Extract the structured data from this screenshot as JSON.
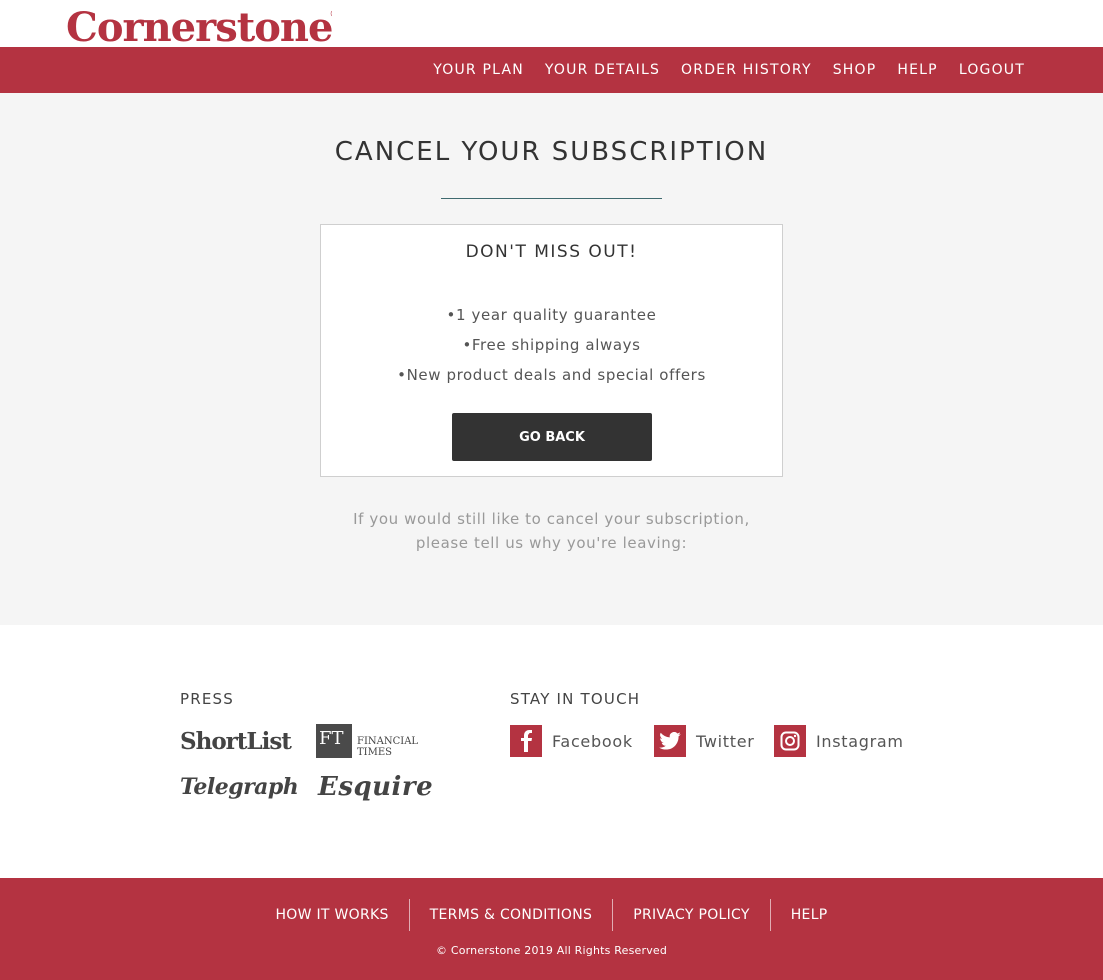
{
  "header": {
    "logo_text": "Cornerstone",
    "logo_mark": "®",
    "nav": [
      {
        "label": "YOUR PLAN"
      },
      {
        "label": "YOUR DETAILS"
      },
      {
        "label": "ORDER HISTORY"
      },
      {
        "label": "SHOP"
      },
      {
        "label": "HELP"
      },
      {
        "label": "LOGOUT"
      }
    ]
  },
  "main": {
    "title": "CANCEL YOUR SUBSCRIPTION",
    "card": {
      "title": "DON'T MISS OUT!",
      "perks": [
        "1 year quality guarantee",
        "Free shipping always",
        "New product deals and special offers"
      ],
      "button_label": "GO BACK"
    },
    "leave_line1": "If you would still like to cancel your subscription,",
    "leave_line2": "please tell us why you're leaving:"
  },
  "press": {
    "heading": "PRESS",
    "logos": [
      {
        "name": "ShortList"
      },
      {
        "box": "FT",
        "line1": "FINANCIAL",
        "line2": "TIMES"
      },
      {
        "name": "Telegraph"
      },
      {
        "name": "Esquire"
      }
    ]
  },
  "social": {
    "heading": "STAY IN TOUCH",
    "links": [
      {
        "label": "Facebook",
        "icon": "facebook-icon"
      },
      {
        "label": "Twitter",
        "icon": "twitter-icon"
      },
      {
        "label": "Instagram",
        "icon": "instagram-icon"
      }
    ]
  },
  "footer": {
    "links": [
      {
        "label": "HOW IT WORKS"
      },
      {
        "label": "TERMS & CONDITIONS"
      },
      {
        "label": "PRIVACY POLICY"
      },
      {
        "label": "HELP"
      }
    ],
    "copyright": "© Cornerstone 2019 All Rights Reserved"
  },
  "colors": {
    "brand": "#b43341",
    "background": "#f5f5f5",
    "button": "#333333",
    "divider": "#3f6a6f"
  }
}
